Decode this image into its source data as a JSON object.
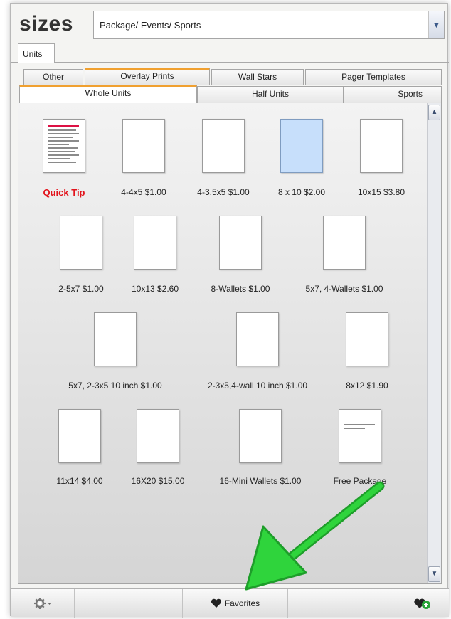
{
  "header": {
    "title": "sizes",
    "category_select": {
      "value": "Package/ Events/ Sports"
    }
  },
  "top_tabs": [
    {
      "label": "Units"
    }
  ],
  "tabs_back_row": [
    {
      "label": "Other"
    },
    {
      "label": "Overlay Prints"
    },
    {
      "label": "Wall Stars"
    },
    {
      "label": "Pager Templates"
    }
  ],
  "tabs_front_row": [
    {
      "label": "Whole Units",
      "selected": true
    },
    {
      "label": "Half Units"
    },
    {
      "label": "Sports"
    }
  ],
  "items": [
    {
      "label": "Quick Tip",
      "icon": "document-thumbnail",
      "highlight": "red"
    },
    {
      "label": "4-4x5 $1.00"
    },
    {
      "label": "4-3.5x5 $1.00"
    },
    {
      "label": "8 x 10 $2.00",
      "selected": true
    },
    {
      "label": "10x15 $3.80"
    },
    {
      "label": "2-5x7 $1.00"
    },
    {
      "label": "10x13 $2.60"
    },
    {
      "label": "8-Wallets $1.00"
    },
    {
      "label": "5x7, 4-Wallets $1.00"
    },
    {
      "label": "5x7, 2-3x5 10 inch $1.00"
    },
    {
      "label": "2-3x5,4-wall  10 inch $1.00"
    },
    {
      "label": "8x12 $1.90"
    },
    {
      "label": "11x14 $4.00"
    },
    {
      "label": "16X20 $15.00"
    },
    {
      "label": "16-Mini Wallets $1.00"
    },
    {
      "label": "Free Package",
      "icon": "document-thumbnail"
    }
  ],
  "bottom_bar": {
    "settings_icon": "gear-icon",
    "favorites_label": "Favorites",
    "favorites_icon": "heart-icon",
    "add_favorite_icon": "heart-plus-icon"
  },
  "colors": {
    "tab_accent": "#f0a030",
    "quick_tip_red": "#e2141c",
    "selected_fill": "#c7dffb",
    "arrow_green": "#2fd43c"
  }
}
